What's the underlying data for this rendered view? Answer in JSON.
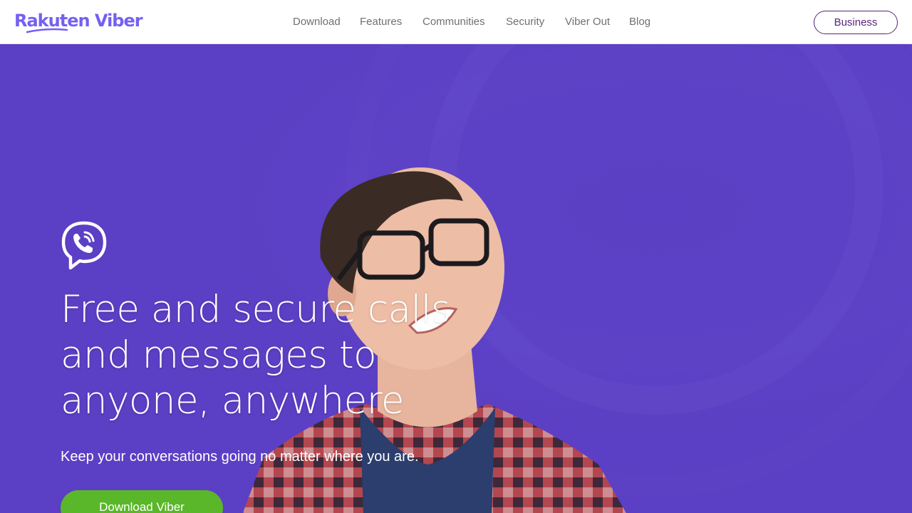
{
  "brand": {
    "logo_text": "Rakuten Viber",
    "accent_color": "#7360f2",
    "hero_color": "#5b3fc4",
    "cta_color": "#5ab72a"
  },
  "nav": {
    "items": [
      {
        "label": "Download"
      },
      {
        "label": "Features"
      },
      {
        "label": "Communities"
      },
      {
        "label": "Security"
      },
      {
        "label": "Viber Out"
      },
      {
        "label": "Blog"
      }
    ],
    "business_label": "Business"
  },
  "hero": {
    "icon": "viber-phone-bubble-icon",
    "headline": "Free and secure calls and messages to anyone, anywhere",
    "subline": "Keep your conversations going no matter where you are.",
    "cta_label": "Download Viber"
  }
}
